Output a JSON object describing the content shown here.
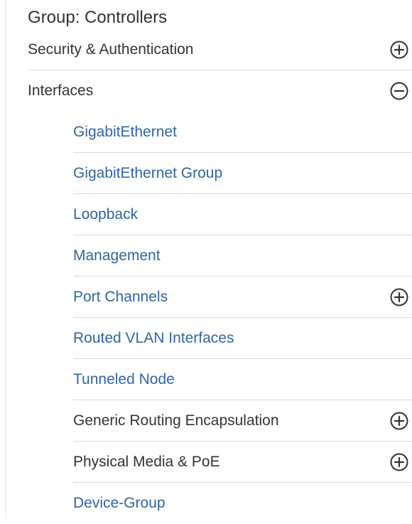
{
  "group": {
    "title": "Group: Controllers"
  },
  "menu": {
    "items": [
      {
        "label": "Security & Authentication",
        "toggle": "expand-icon"
      },
      {
        "label": "Interfaces",
        "toggle": "collapse-icon"
      }
    ],
    "interfaces": [
      {
        "label": "GigabitEthernet"
      },
      {
        "label": "GigabitEthernet Group"
      },
      {
        "label": "Loopback"
      },
      {
        "label": "Management"
      },
      {
        "label": "Port Channels",
        "toggle": "expand-icon"
      },
      {
        "label": "Routed VLAN Interfaces"
      },
      {
        "label": "Tunneled Node"
      },
      {
        "label": "Generic Routing Encapsulation",
        "toggle": "expand-icon"
      },
      {
        "label": "Physical Media & PoE",
        "toggle": "expand-icon"
      },
      {
        "label": "Device-Group"
      }
    ]
  },
  "colors": {
    "link": "#2f65a5",
    "text": "#333333",
    "divider": "#d9d9d9"
  }
}
